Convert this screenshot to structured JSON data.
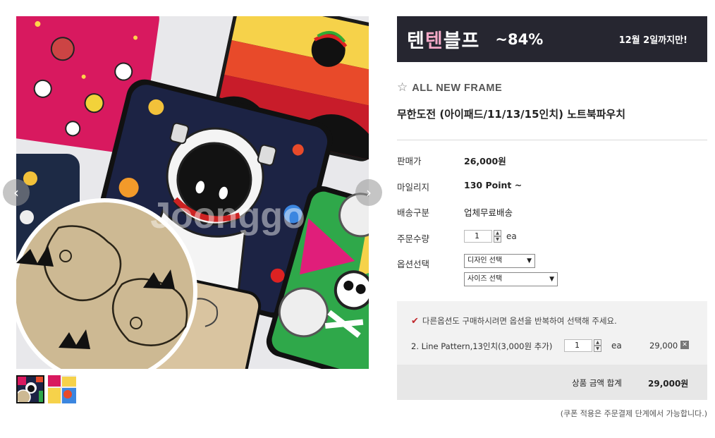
{
  "gallery": {
    "watermark": "Joonggo",
    "prev_icon": "chevron-left-icon",
    "next_icon": "chevron-right-icon",
    "thumbnails": [
      {
        "name": "thumbnail-astronaut",
        "active": true
      },
      {
        "name": "thumbnail-colorful",
        "active": false
      }
    ]
  },
  "banner": {
    "text_1": "텐",
    "text_2": "텐",
    "text_3": "블프",
    "discount": "~84%",
    "until": "12월 2일까지만!",
    "bg_color": "#262630",
    "accent_color": "#f5a9c8"
  },
  "product": {
    "brand": "ALL NEW FRAME",
    "brand_icon": "star-outline-icon",
    "title": "무한도전 (아이패드/11/13/15인치) 노트북파우치"
  },
  "info": {
    "price_label": "판매가",
    "price_value": "26,000원",
    "mileage_label": "마일리지",
    "mileage_value": "130 Point ~",
    "shipping_label": "배송구분",
    "shipping_value": "업체무료배송",
    "qty_label": "주문수량",
    "qty_value": "1",
    "qty_unit": "ea",
    "option_label": "옵션선택",
    "design_select": "디자인 선택",
    "size_select": "사이즈 선택"
  },
  "selection": {
    "notice": "다른옵션도 구매하시려면 옵션을 반복하여 선택해 주세요.",
    "item_name": "2. Line Pattern,13인치(3,000원 추가)",
    "item_qty": "1",
    "item_unit": "ea",
    "item_price": "29,000",
    "delete_icon": "close-icon",
    "total_label": "상품 금액 합계",
    "total_value": "29,000원"
  },
  "coupon_note": "(쿠폰 적용은 주문결제 단계에서 가능합니다.)"
}
